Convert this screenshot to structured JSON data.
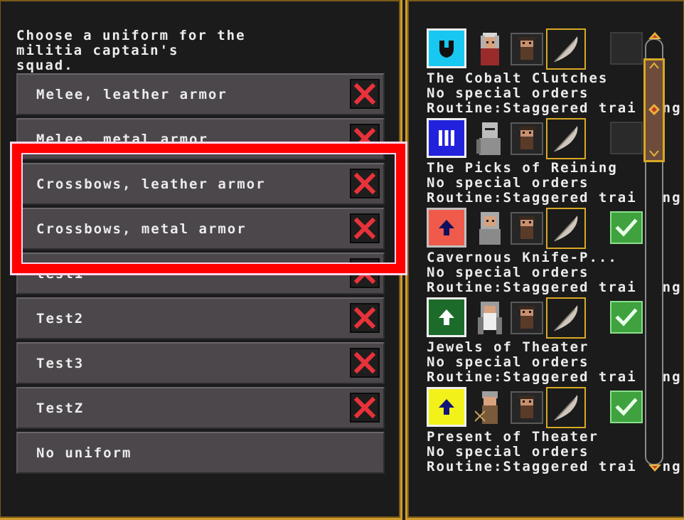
{
  "uniform_dialog": {
    "prompt": "Choose a uniform for the\nmilitia captain's\nsquad.",
    "uniforms": [
      {
        "label": "Melee, leather armor",
        "deletable": true
      },
      {
        "label": "Melee, metal armor",
        "deletable": true
      },
      {
        "label": "Crossbows, leather armor",
        "deletable": true
      },
      {
        "label": "Crossbows, metal armor",
        "deletable": true
      },
      {
        "label": "test1",
        "deletable": true
      },
      {
        "label": "Test2",
        "deletable": true
      },
      {
        "label": "Test3",
        "deletable": true
      },
      {
        "label": "TestZ",
        "deletable": true
      },
      {
        "label": "No uniform",
        "deletable": false
      }
    ],
    "highlighted_rows": [
      "Crossbows, leather armor",
      "Crossbows, metal armor"
    ]
  },
  "squads": [
    {
      "name": "The Cobalt Clutches",
      "orders": "No special orders",
      "routine": "Routine:Staggered trai",
      "routine_tail": "ng",
      "icon": "shield-icon",
      "icon_bg": "#18c8f0",
      "selected": false
    },
    {
      "name": "The Picks of Reining",
      "orders": "No special orders",
      "routine": "Routine:Staggered trai",
      "routine_tail": "ng",
      "icon": "bars-icon",
      "icon_bg": "#2222dd",
      "selected": false
    },
    {
      "name": "Cavernous Knife-P...",
      "orders": "No special orders",
      "routine": "Routine:Staggered trai",
      "routine_tail": "ng",
      "icon": "up-arrow-icon",
      "icon_bg": "#ef5a4a",
      "selected": true
    },
    {
      "name": "Jewels of Theater",
      "orders": "No special orders",
      "routine": "Routine:Staggered trai",
      "routine_tail": "ng",
      "icon": "up-arrow-icon",
      "icon_bg": "#1d6b2a",
      "selected": true
    },
    {
      "name": "Present of Theater",
      "orders": "No special orders",
      "routine": "Routine:Staggered trai",
      "routine_tail": "ng",
      "icon": "up-arrow-icon",
      "icon_bg": "#f2f21a",
      "selected": true
    }
  ],
  "colors": {
    "frame": "#cf9b2c",
    "row": "#4b474b",
    "delete": "#e8323a",
    "highlight": "#ff0000",
    "check": "#3fa23f"
  }
}
